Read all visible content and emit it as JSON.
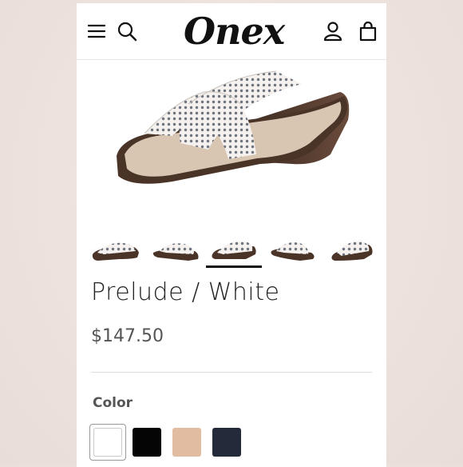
{
  "header": {
    "logo_text": "Onex",
    "icons": [
      "menu-icon",
      "search-icon",
      "account-icon",
      "cart-icon"
    ]
  },
  "gallery": {
    "thumbnail_count": 5,
    "active_thumbnail_index": 2
  },
  "product": {
    "title": "Prelude / White",
    "price": "$147.50"
  },
  "color_option": {
    "label": "Color",
    "swatches": [
      {
        "name": "white",
        "hex": "#ffffff",
        "selected": true
      },
      {
        "name": "black",
        "hex": "#050505",
        "selected": false
      },
      {
        "name": "tan",
        "hex": "#e2bca1",
        "selected": false
      },
      {
        "name": "navy",
        "hex": "#232a3a",
        "selected": false
      }
    ]
  },
  "colors": {
    "background": "#efe3dd",
    "text_dark": "#222222",
    "text_muted": "#555555"
  }
}
